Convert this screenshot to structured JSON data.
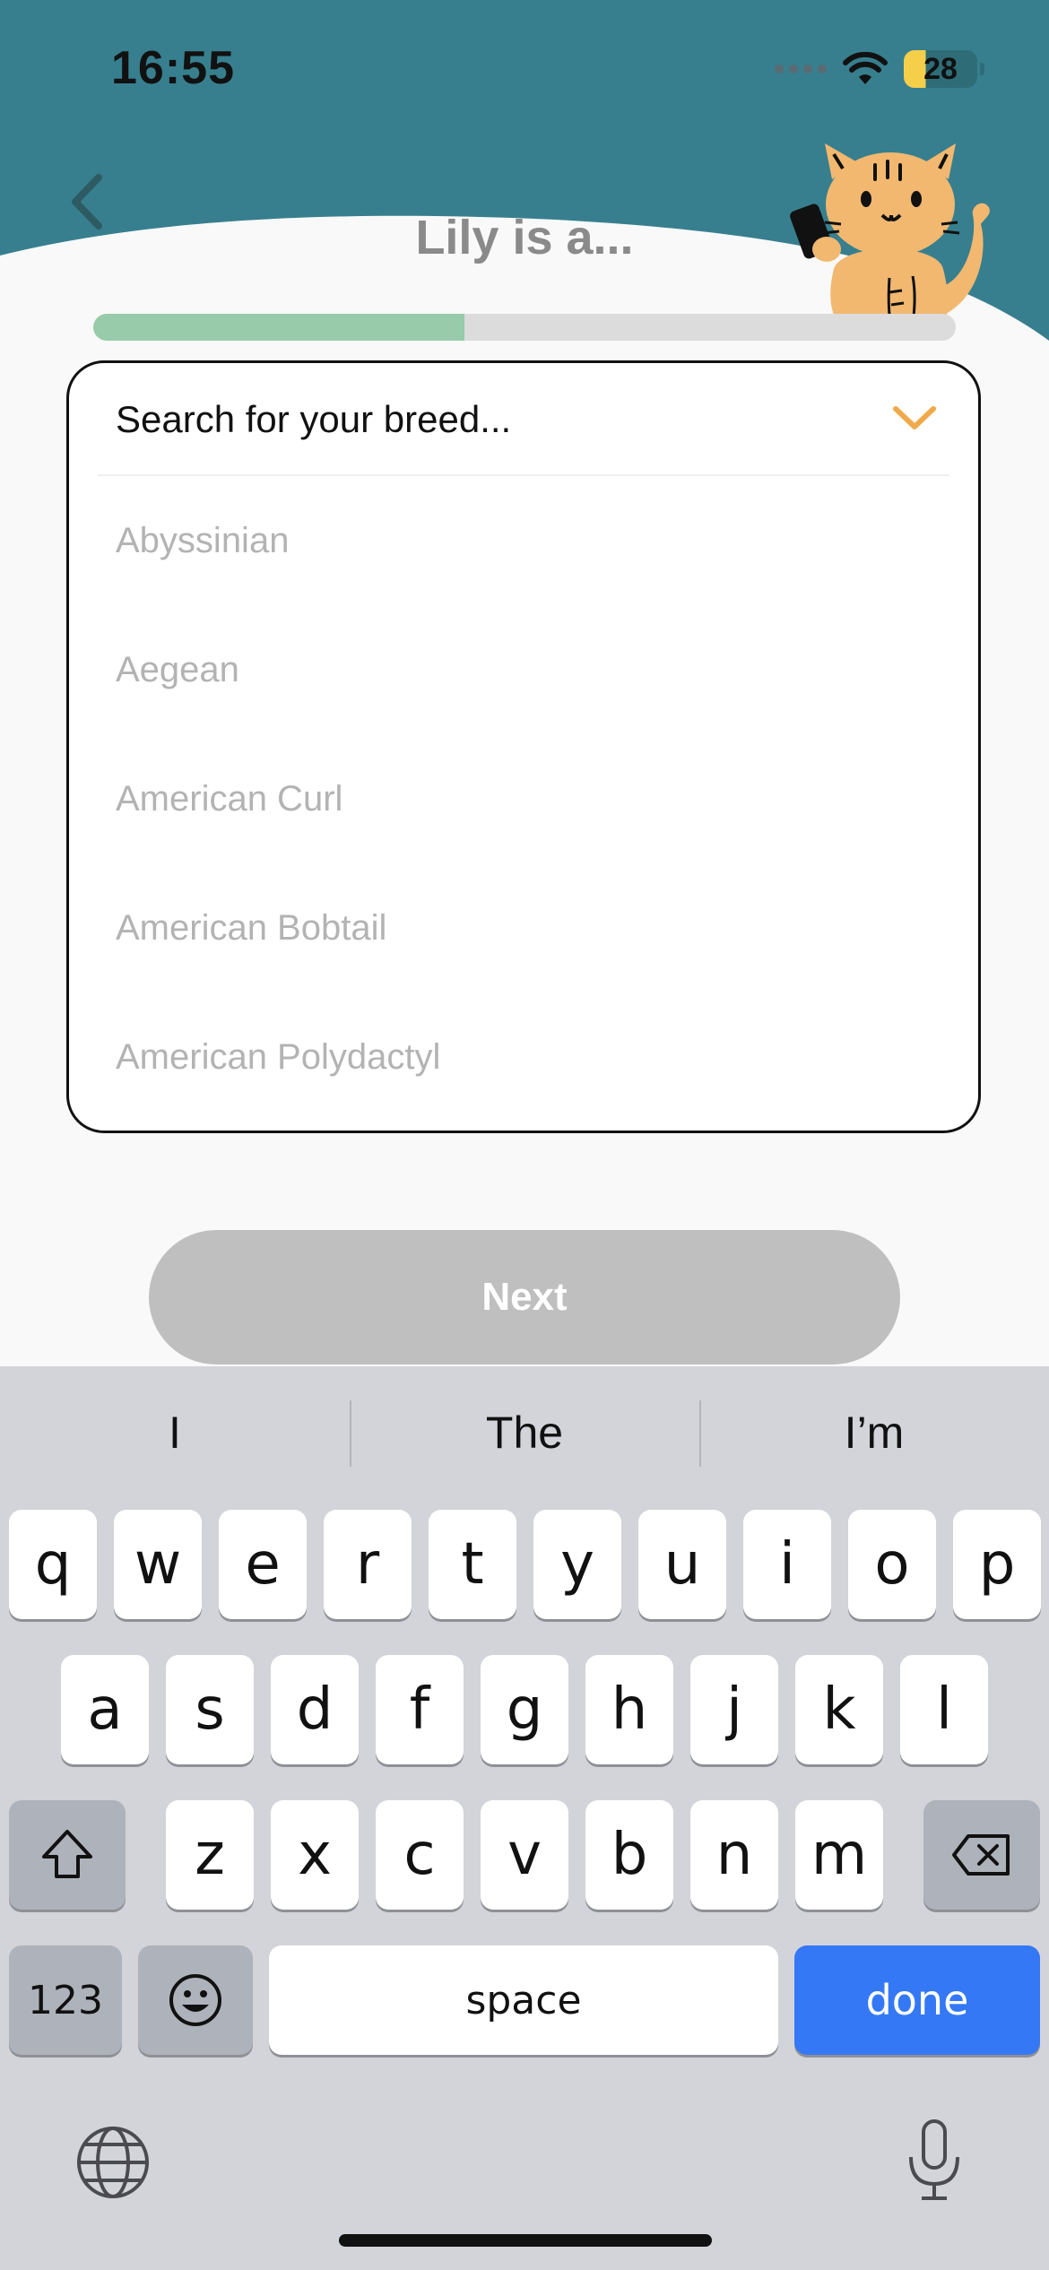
{
  "status_bar": {
    "time": "16:55",
    "battery": "28"
  },
  "header": {
    "title": "Lily is a..."
  },
  "progress": {
    "fraction": 0.43
  },
  "dropdown": {
    "placeholder": "Search for your breed...",
    "options": [
      "Abyssinian",
      "Aegean",
      "American Curl",
      "American Bobtail",
      "American Polydactyl"
    ]
  },
  "next_button": {
    "label": "Next"
  },
  "colors": {
    "header": "#377f8f",
    "progress_fill": "#97cba9",
    "accent_chevron": "#f0a94a",
    "done": "#3478f6"
  },
  "keyboard": {
    "suggestions": [
      "I",
      "The",
      "I’m"
    ],
    "row1": [
      "q",
      "w",
      "e",
      "r",
      "t",
      "y",
      "u",
      "i",
      "o",
      "p"
    ],
    "row2": [
      "a",
      "s",
      "d",
      "f",
      "g",
      "h",
      "j",
      "k",
      "l"
    ],
    "row3": [
      "z",
      "x",
      "c",
      "v",
      "b",
      "n",
      "m"
    ],
    "numbers_label": "123",
    "space_label": "space",
    "done_label": "done",
    "icons": [
      "shift-icon",
      "delete-icon",
      "emoji-icon",
      "globe-icon",
      "microphone-icon"
    ]
  }
}
